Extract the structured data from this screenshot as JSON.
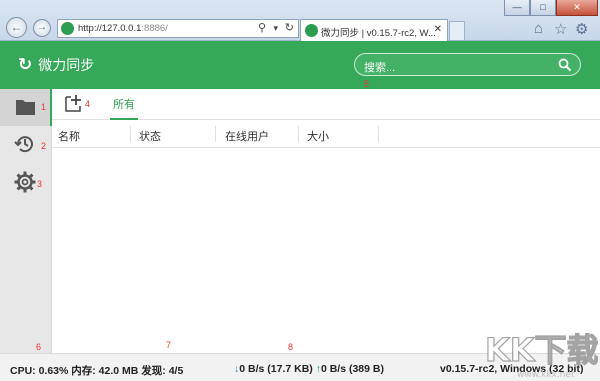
{
  "browser": {
    "back_glyph": "←",
    "forward_glyph": "→",
    "url_host": "http://127.0.0.1",
    "url_port_path": ":8886/",
    "search_glyph": "⚲",
    "dropdown_glyph": "▾",
    "refresh_glyph": "↻",
    "tab_title": "微力同步 | v0.15.7-rc2, W...",
    "tab_close": "✕",
    "min_glyph": "—",
    "max_glyph": "□",
    "close_glyph": "✕",
    "home_glyph": "⌂",
    "star_glyph": "☆",
    "gear_glyph": "⚙"
  },
  "header": {
    "brand_glyph": "↻",
    "brand": "微力同步",
    "search_placeholder": "搜索...",
    "search_icon": "search-icon"
  },
  "sidebar": {
    "items": [
      {
        "icon": "folder-icon",
        "num": "1"
      },
      {
        "icon": "history-icon",
        "num": "2"
      },
      {
        "icon": "settings-gear-icon",
        "num": "3"
      }
    ]
  },
  "toolbar": {
    "add_num": "4",
    "filter_tab": "所有"
  },
  "search_num": "5",
  "table": {
    "columns": [
      "名称",
      "状态",
      "在线用户",
      "大小"
    ]
  },
  "markers": {
    "six": "6",
    "seven": "7",
    "eight": "8"
  },
  "statusbar": {
    "left": "CPU: 0.63% 内存: 42.0 MB 发现: 4/5",
    "down_arrow": "↓",
    "down": "0 B/s (17.7 KB)",
    "up_arrow": "↑",
    "up": "0 B/s (389 B)",
    "version": "v0.15.7-rc2, Windows (32 bit)"
  },
  "watermark": {
    "main": "KK下载",
    "sub": "www.kkx.net"
  },
  "colors": {
    "brand_green": "#36a85a",
    "marker_red": "#e33",
    "down_blue": "#2b7cd3"
  }
}
